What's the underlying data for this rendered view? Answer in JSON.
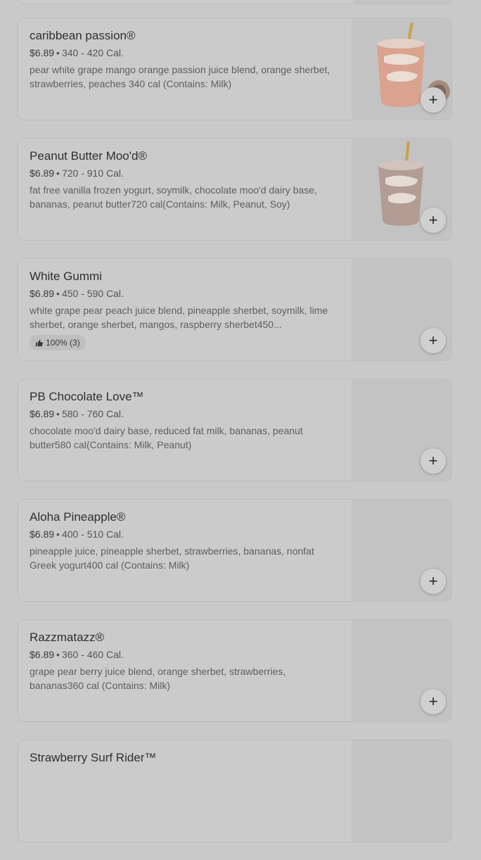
{
  "menu_items": [
    {
      "name": "caribbean passion®",
      "price": "$6.89",
      "calories": "340 - 420 Cal.",
      "description": "pear white grape mango orange passion juice blend, orange sherbet, strawberries, peaches 340 cal (Contains: Milk)",
      "has_image": true,
      "add_label": "+"
    },
    {
      "name": "Peanut Butter Moo'd®",
      "price": "$6.89",
      "calories": "720 - 910 Cal.",
      "description": "fat free vanilla frozen yogurt, soymilk, chocolate moo'd dairy base, bananas, peanut butter720 cal(Contains: Milk, Peanut, Soy)",
      "has_image": true,
      "add_label": "+"
    },
    {
      "name": "White Gummi",
      "price": "$6.89",
      "calories": "450 - 590 Cal.",
      "description": "white grape pear peach juice blend, pineapple sherbet, soymilk, lime sherbet, orange sherbet, mangos, raspberry sherbet450...",
      "rating": "100% (3)",
      "has_image": false,
      "add_label": "+"
    },
    {
      "name": "PB Chocolate Love™",
      "price": "$6.89",
      "calories": "580 - 760 Cal.",
      "description": "chocolate moo'd dairy base, reduced fat milk, bananas, peanut butter580 cal(Contains: Milk, Peanut)",
      "has_image": false,
      "add_label": "+"
    },
    {
      "name": "Aloha Pineapple®",
      "price": "$6.89",
      "calories": "400 - 510 Cal.",
      "description": "pineapple juice, pineapple sherbet, strawberries, bananas, nonfat Greek yogurt400 cal (Contains: Milk)",
      "has_image": false,
      "add_label": "+"
    },
    {
      "name": "Razzmatazz®",
      "price": "$6.89",
      "calories": "360 - 460 Cal.",
      "description": "grape pear berry juice blend, orange sherbet, strawberries, bananas360 cal (Contains: Milk)",
      "has_image": false,
      "add_label": "+"
    },
    {
      "name": "Strawberry Surf Rider™",
      "price": "",
      "calories": "",
      "description": "",
      "has_image": false,
      "add_label": "+"
    }
  ],
  "icons": {
    "add": "plus-icon",
    "rating": "thumbs-up-icon",
    "image": "smoothie-cup-icon"
  },
  "colors": {
    "overlay_background": "#c9c9c9",
    "card_background": "#cbcbcb",
    "image_background": "#c3c3c3",
    "cup_orange": "#d9a38f",
    "cup_brown": "#b39c94",
    "straw": "#c9a24a"
  }
}
